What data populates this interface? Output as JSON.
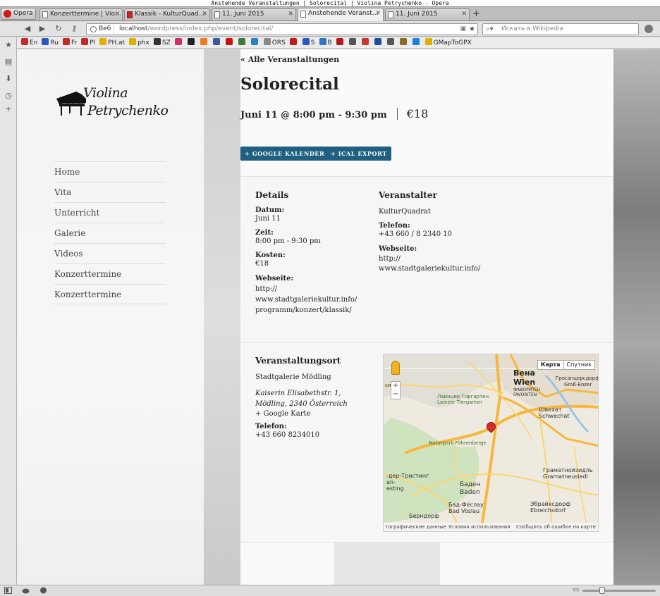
{
  "window_title": "Anstehende Veranstaltungen | Solorecital | Violina Petrychenko - Opera",
  "browser": {
    "menu_label": "Opera"
  },
  "tabs": [
    {
      "label": "Konzerttermine | Vio…",
      "active": false
    },
    {
      "label": "Klassik - KulturQuad…",
      "active": false
    },
    {
      "label": "11. Juni 2015",
      "active": false
    },
    {
      "label": "Anstehende Veranst…",
      "active": true
    },
    {
      "label": "11. Juni 2015",
      "active": false
    }
  ],
  "address": {
    "badge": "Веб",
    "url_host": "localhost",
    "url_path": "/wordpress/index.php/event/solorecital/"
  },
  "search": {
    "placeholder": "Искать в Wikipedia"
  },
  "bookmarks": [
    {
      "label": "En",
      "color": "#c22a2a"
    },
    {
      "label": "Ru",
      "color": "#2a58c2"
    },
    {
      "label": "Fr",
      "color": "#c22a2a"
    },
    {
      "label": "Pl",
      "color": "#c22a2a"
    },
    {
      "label": "PH.at",
      "color": "#e0b000"
    },
    {
      "label": "phx",
      "color": "#e0b000"
    },
    {
      "label": "SZ",
      "color": "#333333"
    },
    {
      "label": "",
      "color": "#d0306a"
    },
    {
      "label": "",
      "color": "#222222"
    },
    {
      "label": "",
      "color": "#ef7b1a"
    },
    {
      "label": "",
      "color": "#3b5998"
    },
    {
      "label": "",
      "color": "#cc1010"
    },
    {
      "label": "",
      "color": "#3a7a3a"
    },
    {
      "label": "",
      "color": "#2c7fc2"
    },
    {
      "label": "ORS",
      "color": "#8a8a8a"
    },
    {
      "label": "",
      "color": "#c21a1a"
    },
    {
      "label": "S",
      "color": "#2a58c2"
    },
    {
      "label": "B",
      "color": "#2a78c2"
    },
    {
      "label": "",
      "color": "#b21a1a"
    },
    {
      "label": "",
      "color": "#555555"
    },
    {
      "label": "",
      "color": "#cc3333"
    },
    {
      "label": "",
      "color": "#1d4e9e"
    },
    {
      "label": "",
      "color": "#555555"
    },
    {
      "label": "",
      "color": "#8a6a2a"
    },
    {
      "label": "",
      "color": "#1a82d6"
    },
    {
      "label": "GMapToGPX",
      "color": "#e0b000"
    }
  ],
  "site": {
    "logo_line1": "Violina",
    "logo_line2": "Petrychenko",
    "menu": [
      "Home",
      "Vita",
      "Unterricht",
      "Galerie",
      "Videos",
      "Konzerttermine",
      "Konzerttermine"
    ]
  },
  "event": {
    "back_link": "« Alle Veranstaltungen",
    "title": "Solorecital",
    "datetime": "Juni 11 @ 8:00 pm - 9:30 pm",
    "cost": "€18",
    "btn_google": "+ GOOGLE KALENDER",
    "btn_ical": "+ ICAL EXPORT"
  },
  "details": {
    "heading": "Details",
    "date_label": "Datum:",
    "date_value": "Juni 11",
    "time_label": "Zeit:",
    "time_value": "8:00 pm - 9:30 pm",
    "cost_label": "Kosten:",
    "cost_value": "€18",
    "web_label": "Webseite:",
    "web_line1": "http://",
    "web_line2": "www.stadtgaleriekultur.info/",
    "web_line3": "programm/konzert/klassik/"
  },
  "organizer": {
    "heading": "Veranstalter",
    "name": "KulturQuadrat",
    "phone_label": "Telefon:",
    "phone_value": "+43 660 / 8 2340 10",
    "web_label": "Webseite:",
    "web_line1": "http://",
    "web_line2": "www.stadtgaleriekultur.info/"
  },
  "venue": {
    "heading": "Veranstaltungsort",
    "name": "Stadtgalerie Mödling",
    "addr_line1": "Kaiserin Elisabethstr. 1,",
    "addr_line2": "Mödling, 2340 Österreich",
    "map_link": "+ Google Karte",
    "phone_label": "Telefon:",
    "phone_value": "+43 660 8234010"
  },
  "map": {
    "type_map": "Карта",
    "type_sat": "Спутник",
    "zoom_plus": "+",
    "zoom_minus": "−",
    "labels": {
      "wien1": "Вена",
      "wien2": "Wien",
      "favoriten1": "ФАВОРИТЕН",
      "favoriten2": "FAVORITEN",
      "grossenzersdorf1": "Гросэнцерсдорф",
      "grossenzersdorf2": "Groß-Enzer",
      "tiergarten1": "Лайнцер Тиргартен",
      "tiergarten2": "Lainzer Tiergarten",
      "schwechat1": "Швехат",
      "schwechat2": "Schwechat",
      "naturpark": "Naturpark Föhrenberge",
      "gramat1": "Граматнойзидль",
      "gramat2": "Gramatneusiedl",
      "baden1": "Баден",
      "baden2": "Baden",
      "voeslau1": "Бад-Фёслау",
      "voeslau2": "Bad Vöslau",
      "ebreich1": "Эбрайхсдорф",
      "ebreich2": "Ebreichsdorf",
      "berndorf": "Берндорф",
      "tristing1": "-дер-Тристинг",
      "tristing2": "an-",
      "esting": "esting",
      "left_a": "сиде"
    },
    "footer_data": "тографические данные",
    "footer_terms": "Условия использования",
    "footer_report": "Сообщить об ошибке на карте"
  }
}
